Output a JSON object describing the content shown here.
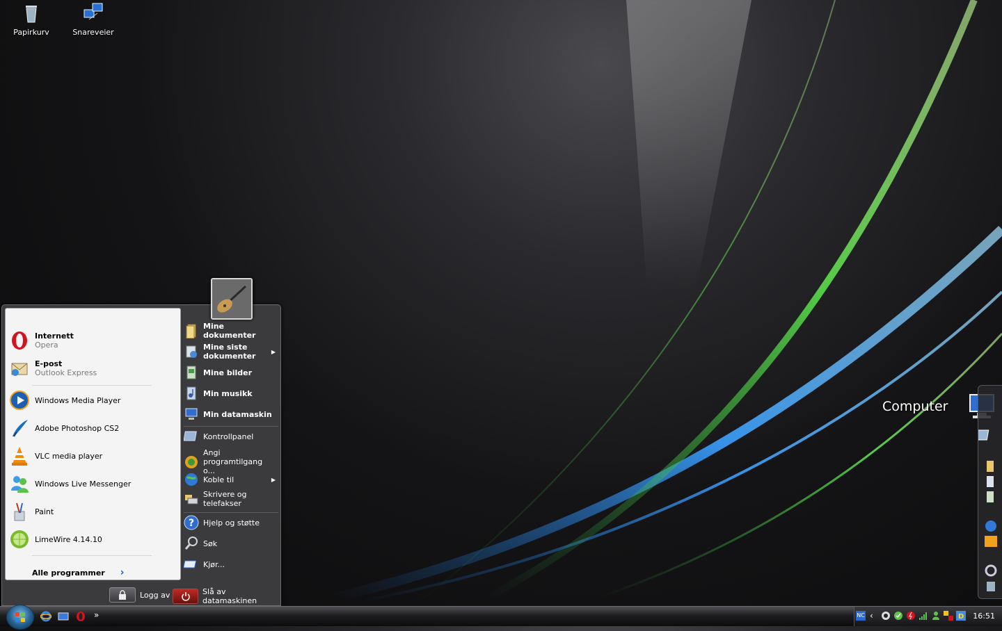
{
  "desktop": {
    "icons": [
      {
        "label": "Papirkurv",
        "icon": "recycle-bin-icon"
      },
      {
        "label": "Snareveier",
        "icon": "network-icon"
      }
    ]
  },
  "start_menu": {
    "pinned": [
      {
        "title": "Internett",
        "subtitle": "Opera",
        "icon": "opera-icon"
      },
      {
        "title": "E-post",
        "subtitle": "Outlook Express",
        "icon": "outlook-express-icon"
      }
    ],
    "recent": [
      {
        "title": "Windows Media Player",
        "icon": "media-player-icon"
      },
      {
        "title": "Adobe Photoshop CS2",
        "icon": "photoshop-icon"
      },
      {
        "title": "VLC media player",
        "icon": "vlc-icon"
      },
      {
        "title": "Windows Live Messenger",
        "icon": "messenger-icon"
      },
      {
        "title": "Paint",
        "icon": "paint-icon"
      },
      {
        "title": "LimeWire 4.14.10",
        "icon": "limewire-icon"
      }
    ],
    "all_programs": "Alle programmer",
    "places": [
      {
        "label": "Mine dokumenter",
        "icon": "documents-folder-icon"
      },
      {
        "label": "Mine siste dokumenter",
        "icon": "recent-documents-icon"
      },
      {
        "label": "Mine bilder",
        "icon": "pictures-folder-icon"
      },
      {
        "label": "Min musikk",
        "icon": "music-folder-icon"
      },
      {
        "label": "Min datamaskin",
        "icon": "computer-icon"
      }
    ],
    "system": [
      {
        "label": "Kontrollpanel",
        "icon": "control-panel-icon"
      },
      {
        "label": "Angi programtilgang o...",
        "icon": "program-access-icon"
      },
      {
        "label": "Koble til",
        "icon": "connect-icon"
      },
      {
        "label": "Skrivere og telefakser",
        "icon": "printers-icon"
      }
    ],
    "tools": [
      {
        "label": "Hjelp og støtte",
        "icon": "help-icon"
      },
      {
        "label": "Søk",
        "icon": "search-icon"
      },
      {
        "label": "Kjør...",
        "icon": "run-icon"
      }
    ],
    "logoff": "Logg av",
    "shutdown": "Slå av datamaskinen"
  },
  "dock": {
    "label": "Computer"
  },
  "taskbar": {
    "clock": "16:51",
    "quicklaunch_more": "»",
    "tray_text": "NC"
  },
  "colors": {
    "accent": "#1a56b0",
    "menu_dark": "#3b3b3d",
    "menu_light": "#f4f4f4"
  }
}
